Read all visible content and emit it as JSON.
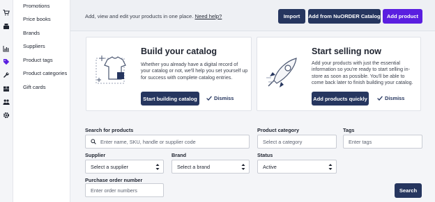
{
  "rail": {
    "icons": [
      "cart-icon",
      "register-icon",
      "chart-icon",
      "tag-icon",
      "wrench-icon",
      "store-icon",
      "people-icon",
      "gear-icon"
    ]
  },
  "subnav": {
    "items": [
      "Promotions",
      "Price books",
      "Brands",
      "Suppliers",
      "Product tags",
      "Product categories",
      "Gift cards"
    ]
  },
  "topbar": {
    "intro_text": "Add, view and edit your products in one place.",
    "help_link": "Need help?",
    "import_label": "Import",
    "nuorder_label": "Add from NuORDER Catalog",
    "add_product_label": "Add product"
  },
  "catalog_card": {
    "title": "Build your catalog",
    "body": "Whether you already have a digital record of your catalog or not, we'll help you set yourself up for success with complete catalog entries.",
    "button_label": "Start building catalog",
    "dismiss_label": "Dismiss"
  },
  "selling_card": {
    "title": "Start selling now",
    "body": "Add your products with just the essential information so you're ready to start selling in-store as soon as possible. You'll be able to come back later to finish building your catalog.",
    "button_label": "Add products quickly",
    "dismiss_label": "Dismiss"
  },
  "filters": {
    "search_label": "Search for products",
    "search_placeholder": "Enter name, SKU, handle or supplier code",
    "category_label": "Product category",
    "category_value": "Select a category",
    "tags_label": "Tags",
    "tags_placeholder": "Enter tags",
    "supplier_label": "Supplier",
    "supplier_value": "Select a supplier",
    "brand_label": "Brand",
    "brand_value": "Select a brand",
    "status_label": "Status",
    "status_value": "Active",
    "po_label": "Purchase order number",
    "po_placeholder": "Enter order numbers",
    "search_button": "Search"
  },
  "colors": {
    "primary_dark": "#26365f",
    "accent_purple": "#5a1ee0"
  }
}
